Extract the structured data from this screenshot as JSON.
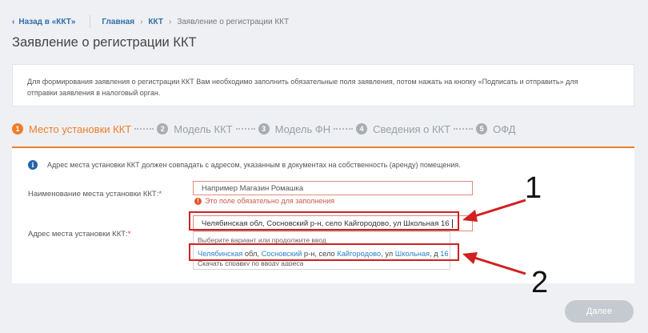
{
  "nav": {
    "back_label": "Назад в «ККТ»",
    "breadcrumb": [
      "Главная",
      "ККТ",
      "Заявление о регистрации ККТ"
    ]
  },
  "page": {
    "title": "Заявление о регистрации ККТ",
    "info_line1": "Для формирования заявления о регистрации ККТ Вам необходимо заполнить обязательные поля заявления, потом нажать на кнопку «Подписать и отправить» для",
    "info_line2": "отправки заявления в налоговый орган."
  },
  "steps": [
    {
      "num": "1",
      "label": "Место установки ККТ",
      "active": true
    },
    {
      "num": "2",
      "label": "Модель ККТ",
      "active": false
    },
    {
      "num": "3",
      "label": "Модель ФН",
      "active": false
    },
    {
      "num": "4",
      "label": "Сведения о ККТ",
      "active": false
    },
    {
      "num": "5",
      "label": "ОФД",
      "active": false
    }
  ],
  "form": {
    "notice_icon": "i",
    "notice": "Адрес места установки ККТ должен совпадать с адресом, указанным в документах на собственность (аренду) помещения.",
    "name_label": "Наименование места установки ККТ:",
    "name_placeholder": "Например Магазин Ромашка",
    "name_error_icon": "!",
    "name_error": "Это поле обязательно для заполнения",
    "address_label": "Адрес места установки ККТ:",
    "required_mark": "*",
    "address_value": "Челябинская обл, Сосновский р-н, село Кайгородово, ул Школьная 16",
    "dropdown_hint": "Выберите вариант или продолжите ввод",
    "suggestion": {
      "p1": "Челябинская",
      "p2": " обл, ",
      "p3": "Сосновский",
      "p4": " р-н, село ",
      "p5": "Кайгородово",
      "p6": ", ул ",
      "p7": "Школьная",
      "p8": ", д ",
      "p9": "16"
    },
    "help_link": "Скачать справку по вводу адреса"
  },
  "annotations": [
    "1",
    "2"
  ],
  "next_button": "Далее",
  "colors": {
    "accent": "#ef7d2a",
    "link": "#2f6fa8",
    "annotation_red": "#d0201f",
    "disabled_button": "#c5cad0"
  }
}
